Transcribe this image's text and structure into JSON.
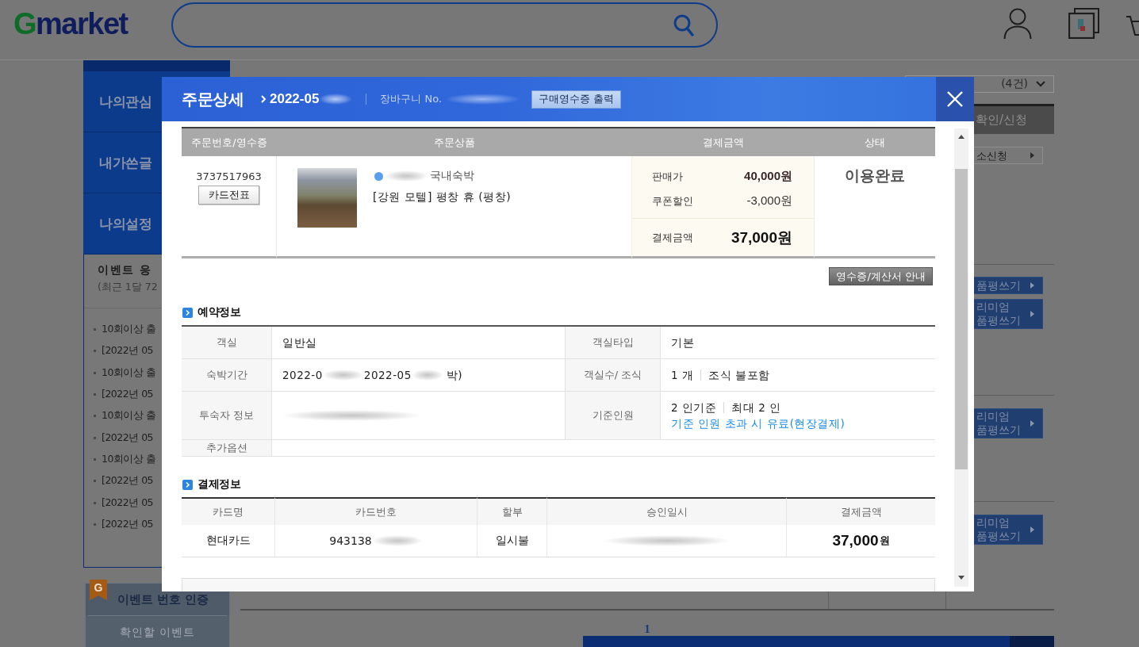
{
  "header": {
    "logo": "Gmarket"
  },
  "sidebar": {
    "tabs": [
      "나의관심",
      "내가쓴글",
      "나의설정"
    ],
    "event_box": {
      "title": "이벤트 응",
      "subtitle": "(최근 1달 72",
      "items": [
        "10회이상 출",
        "[2022년 05",
        "10회이상 출",
        "[2022년 05",
        "10회이상 출",
        "[2022년 05",
        "10회이상 출",
        "[2022년 05",
        "[2022년 05",
        "[2022년 05"
      ]
    },
    "event_auth": {
      "badge": "G",
      "title": "이벤트 번호 인증",
      "text": "확인할 이벤트"
    }
  },
  "main": {
    "sort_select": "(4건)",
    "action_groups": [
      [
        {
          "kind": "dark",
          "lines": [
            "확인/신청"
          ]
        },
        {
          "kind": "outline",
          "lines": [
            "소신청"
          ]
        }
      ],
      [
        {
          "kind": "blue",
          "lines": [
            "품평쓰기"
          ]
        },
        {
          "kind": "blue",
          "lines": [
            "리미엄",
            "품평쓰기"
          ]
        }
      ],
      [
        {
          "kind": "blue",
          "lines": [
            "리미엄",
            "품평쓰기"
          ]
        }
      ],
      [
        {
          "kind": "blue",
          "lines": [
            "리미엄",
            "품평쓰기"
          ]
        }
      ]
    ],
    "pagination": [
      "1"
    ]
  },
  "modal": {
    "title": "주문상세",
    "order_date": [
      {
        "kind": "text",
        "text": "2022-05"
      },
      {
        "kind": "blurred"
      }
    ],
    "cart_no": [
      {
        "kind": "text",
        "text": "장바구니 No."
      },
      {
        "kind": "blurred"
      }
    ],
    "print_button": "구매영수증 출력",
    "order_table": {
      "columns": [
        "주문번호/영수증",
        "주문상품",
        "결제금액",
        "상태"
      ],
      "order_no": "3737517963",
      "slip_button": "카드전표",
      "category": [
        {
          "kind": "dot"
        },
        {
          "kind": "blurred"
        },
        {
          "kind": "text",
          "text": "국내숙박"
        }
      ],
      "product": "[강원 모텔] 평창 휴 (평창)",
      "amounts": [
        {
          "kind": "price",
          "label": "판매가",
          "value": "40,000원"
        },
        {
          "kind": "discount",
          "label": "쿠폰할인",
          "value": "-3,000원"
        },
        {
          "kind": "total",
          "label": "결제금액",
          "value": "37,000원"
        }
      ],
      "status": "이용완료"
    },
    "guide_button": "영수증/계산서 안내",
    "reservation": {
      "title": "예약정보",
      "rows": [
        [
          {
            "label": "객실",
            "lines": [
              [
                {
                  "kind": "text",
                  "text": "일반실"
                }
              ]
            ]
          },
          {
            "label": "객실타입",
            "lines": [
              [
                {
                  "kind": "text",
                  "text": "기본"
                }
              ]
            ]
          }
        ],
        [
          {
            "label": "숙박기간",
            "lines": [
              [
                {
                  "kind": "text",
                  "text": "2022-0"
                },
                {
                  "kind": "blurred"
                },
                {
                  "kind": "text",
                  "text": "2022-05"
                },
                {
                  "kind": "blurred"
                },
                {
                  "kind": "text",
                  "text": "박)"
                }
              ]
            ]
          },
          {
            "label": "객실수/ 조식",
            "lines": [
              [
                {
                  "kind": "text",
                  "text": "1 개"
                },
                {
                  "kind": "divider"
                },
                {
                  "kind": "text",
                  "text": "조식 불포함"
                }
              ]
            ]
          }
        ],
        [
          {
            "label": "투숙자 정보",
            "lines": [
              [
                {
                  "kind": "blurred"
                }
              ]
            ]
          },
          {
            "label": "기준인원",
            "lines": [
              [
                {
                  "kind": "text",
                  "text": "2 인기준"
                },
                {
                  "kind": "divider"
                },
                {
                  "kind": "text",
                  "text": "최대 2 인"
                }
              ],
              [
                {
                  "kind": "note",
                  "text": "기준 인원 초과 시 유료(현장결제)"
                }
              ]
            ]
          }
        ],
        [
          {
            "label": "추가옵션"
          }
        ]
      ]
    },
    "payment": {
      "title": "결제정보",
      "columns": [
        "카드명",
        "카드번호",
        "할부",
        "승인일시",
        "결제금액"
      ],
      "cells": [
        [
          {
            "kind": "text",
            "text": "현대카드"
          }
        ],
        [
          {
            "kind": "text",
            "text": "943138"
          },
          {
            "kind": "blurred"
          }
        ],
        [
          {
            "kind": "text",
            "text": "일시불"
          }
        ],
        [
          {
            "kind": "blurred"
          }
        ],
        [
          {
            "kind": "amount",
            "text": "37,000"
          },
          {
            "kind": "unit",
            "text": "원"
          }
        ]
      ]
    }
  }
}
